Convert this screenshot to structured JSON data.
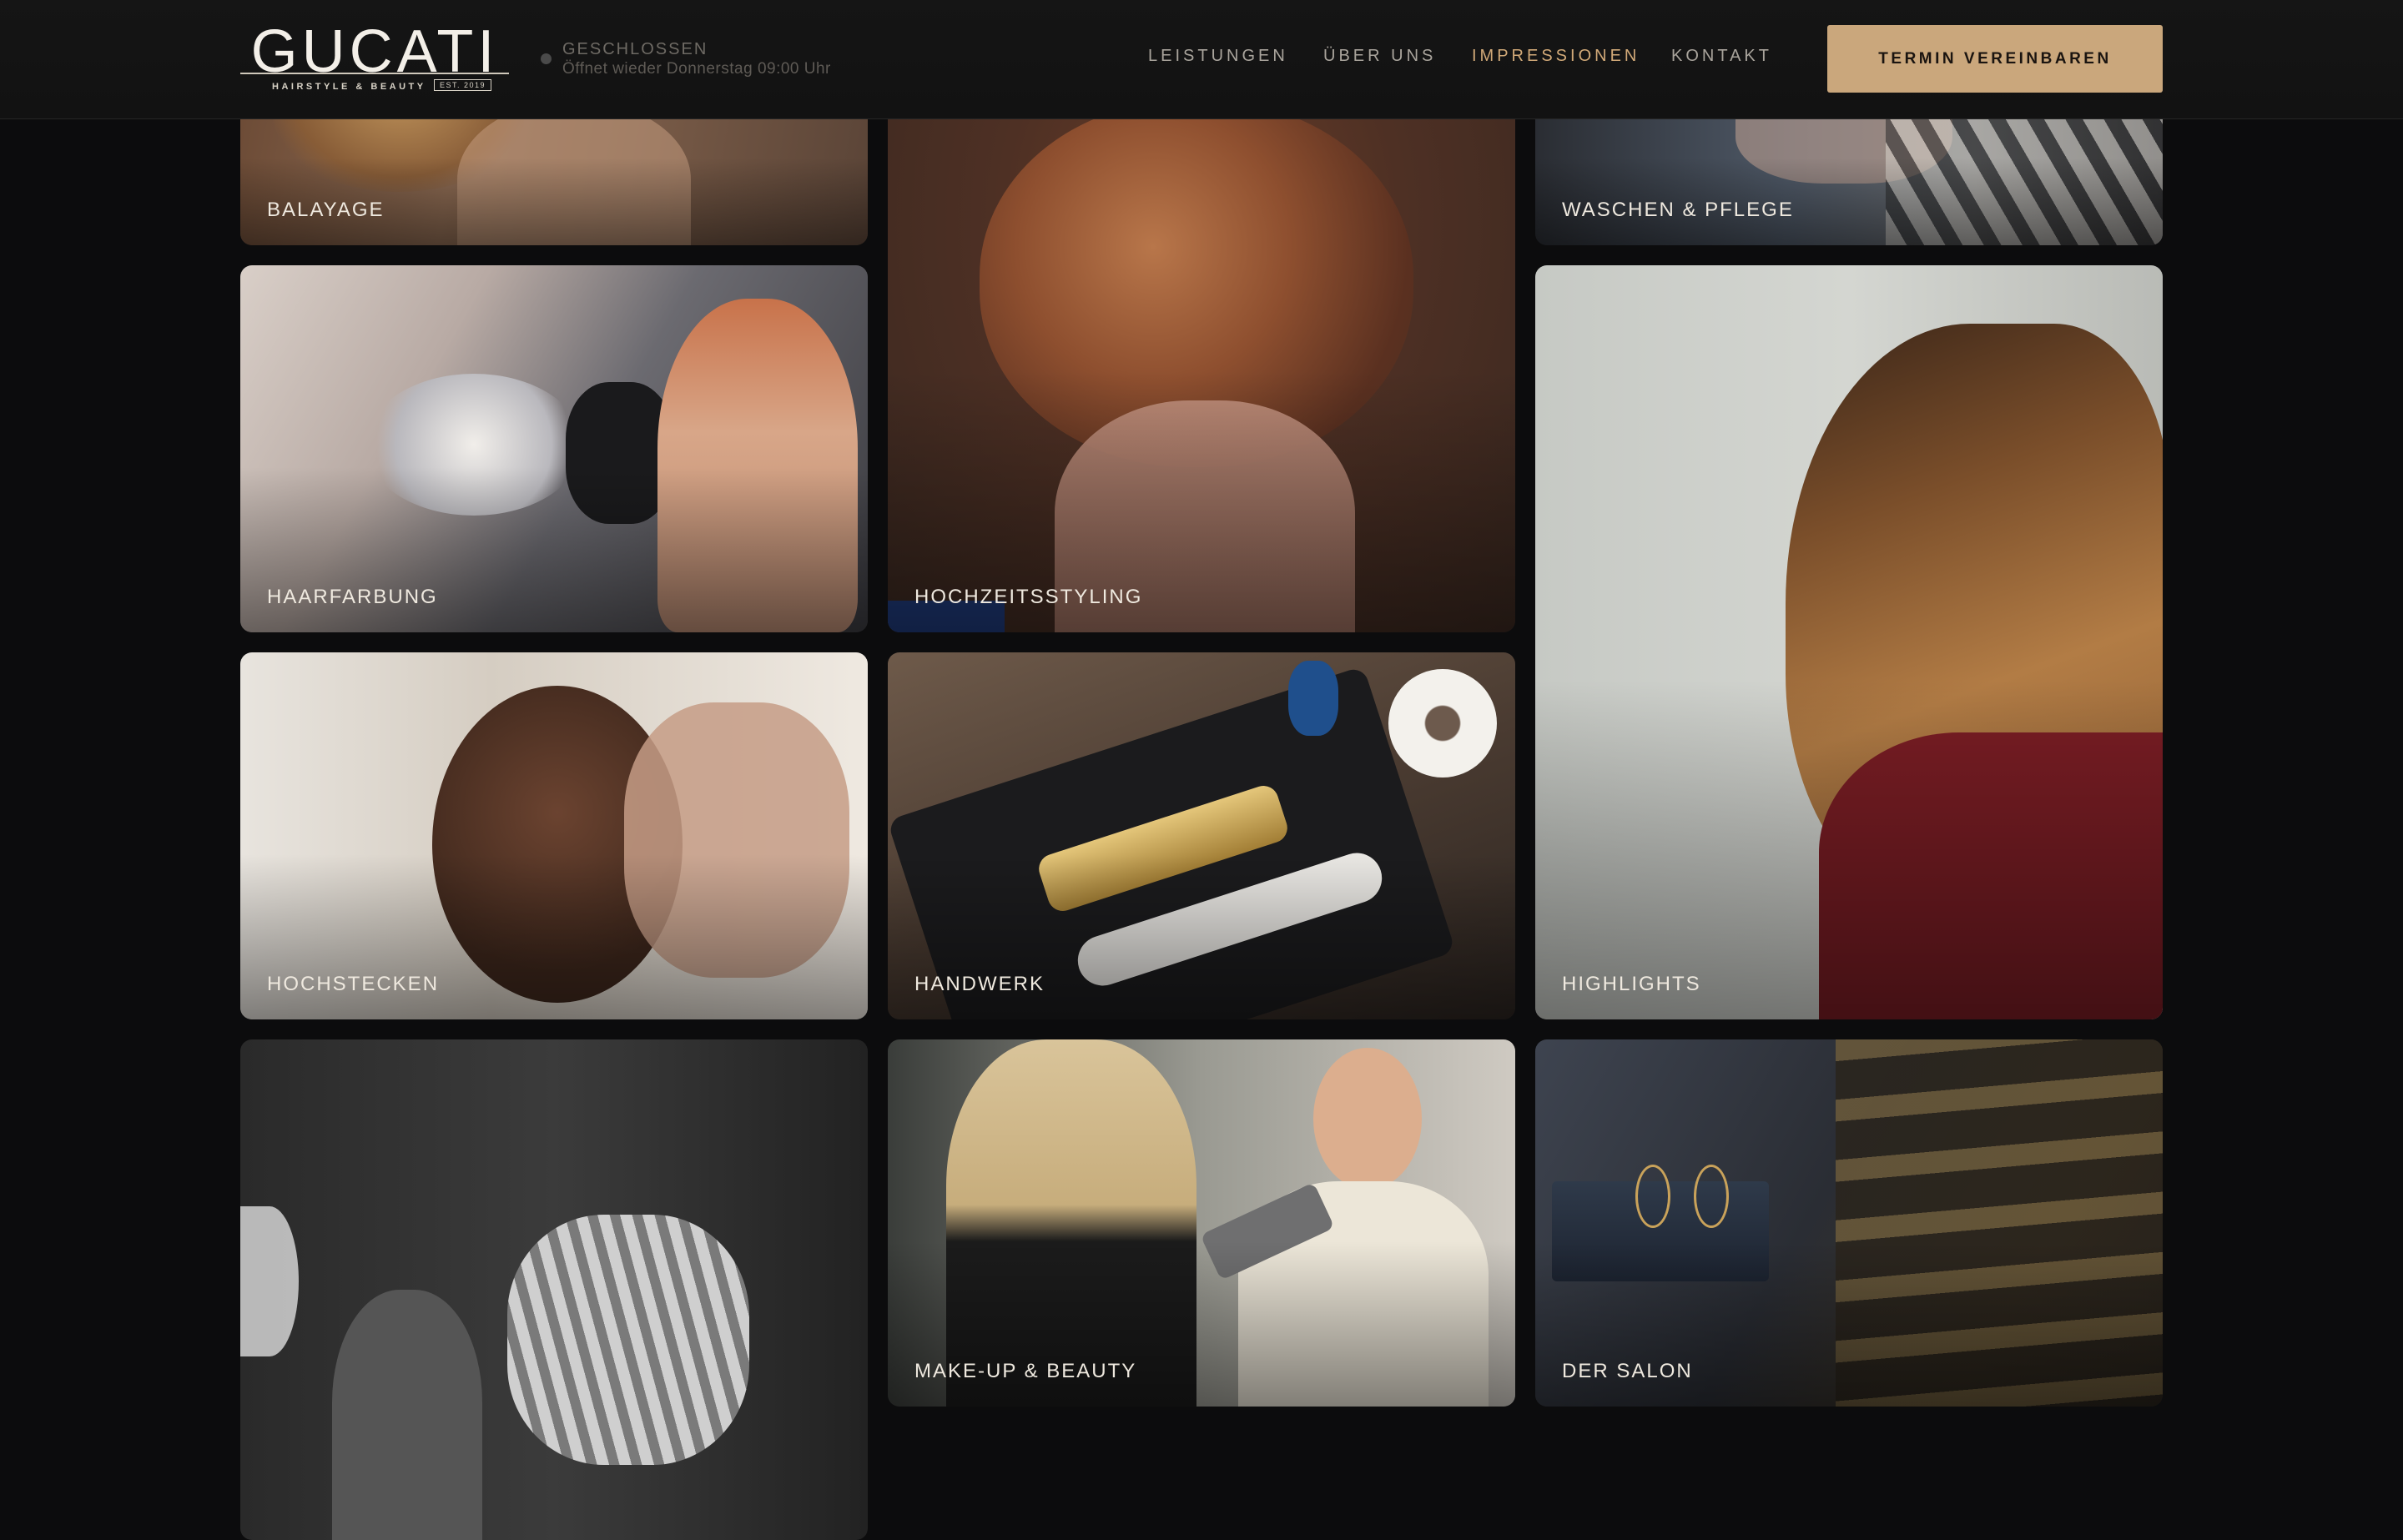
{
  "brand": {
    "name": "GUCATI",
    "tagline": "HAIRSTYLE & BEAUTY",
    "est": "EST. 2019"
  },
  "status": {
    "state": "GESCHLOSSEN",
    "note": "Öffnet wieder Donnerstag 09:00 Uhr"
  },
  "nav": {
    "items": [
      {
        "label": "LEISTUNGEN"
      },
      {
        "label": "ÜBER UNS"
      },
      {
        "label": "IMPRESSIONEN"
      },
      {
        "label": "KONTAKT"
      }
    ],
    "active": "IMPRESSIONEN",
    "cta": "TERMIN VEREINBAREN"
  },
  "colors": {
    "accent": "#caa77c",
    "nav_active": "#d1a978",
    "background": "#0c0c0d"
  },
  "gallery": {
    "tiles": [
      {
        "caption": "BALAYAGE"
      },
      {
        "caption": "HOCHZEITSSTYLING"
      },
      {
        "caption": "WASCHEN & PFLEGE"
      },
      {
        "caption": "HAARFARBUNG"
      },
      {
        "caption": "HIGHLIGHTS"
      },
      {
        "caption": "HOCHSTECKEN"
      },
      {
        "caption": "HANDWERK"
      },
      {
        "caption": ""
      },
      {
        "caption": "MAKE-UP & BEAUTY"
      },
      {
        "caption": "DER SALON"
      }
    ]
  }
}
